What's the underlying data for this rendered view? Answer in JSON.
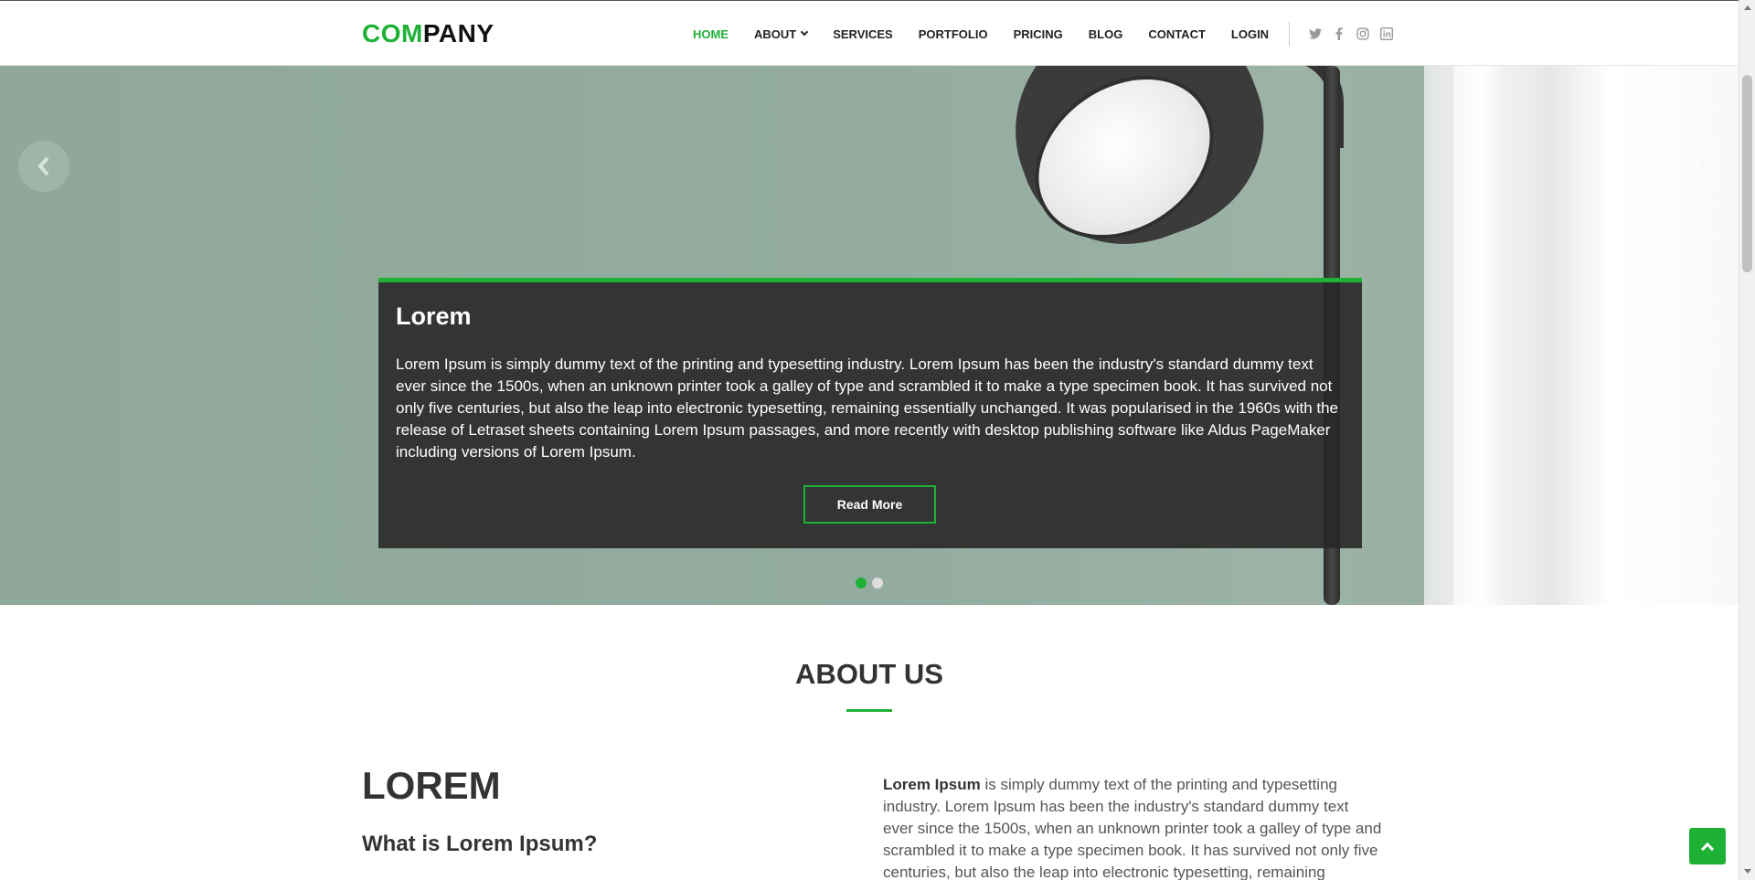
{
  "header": {
    "logo_accent": "COM",
    "logo_rest": "PANY",
    "nav": {
      "home": "HOME",
      "about": "ABOUT",
      "services": "SERVICES",
      "portfolio": "PORTFOLIO",
      "pricing": "PRICING",
      "blog": "BLOG",
      "contact": "CONTACT",
      "login": "LOGIN"
    },
    "social_icons": [
      "twitter-icon",
      "facebook-icon",
      "instagram-icon",
      "linkedin-icon"
    ]
  },
  "hero": {
    "slide_title": "Lorem",
    "slide_text": "Lorem Ipsum is simply dummy text of the printing and typesetting industry. Lorem Ipsum has been the industry's standard dummy text ever since the 1500s, when an unknown printer took a galley of type and scrambled it to make a type specimen book. It has survived not only five centuries, but also the leap into electronic typesetting, remaining essentially unchanged. It was popularised in the 1960s with the release of Letraset sheets containing Lorem Ipsum passages, and more recently with desktop publishing software like Aldus PageMaker including versions of Lorem Ipsum.",
    "button_label": "Read More",
    "slide_count": 2,
    "active_slide": 1
  },
  "about": {
    "section_title": "ABOUT US",
    "heading": "LOREM",
    "subheading": "What is Lorem Ipsum?",
    "text_bold": "Lorem Ipsum",
    "text_rest": " is simply dummy text of the printing and typesetting industry. Lorem Ipsum has been the industry's standard dummy text ever since the 1500s, when an unknown printer took a galley of type and scrambled it to make a type specimen book. It has survived not only five centuries, but also the leap into electronic typesetting, remaining"
  },
  "colors": {
    "accent": "#1fb136",
    "caption_bg": "#282828",
    "text_dark": "#333333"
  }
}
